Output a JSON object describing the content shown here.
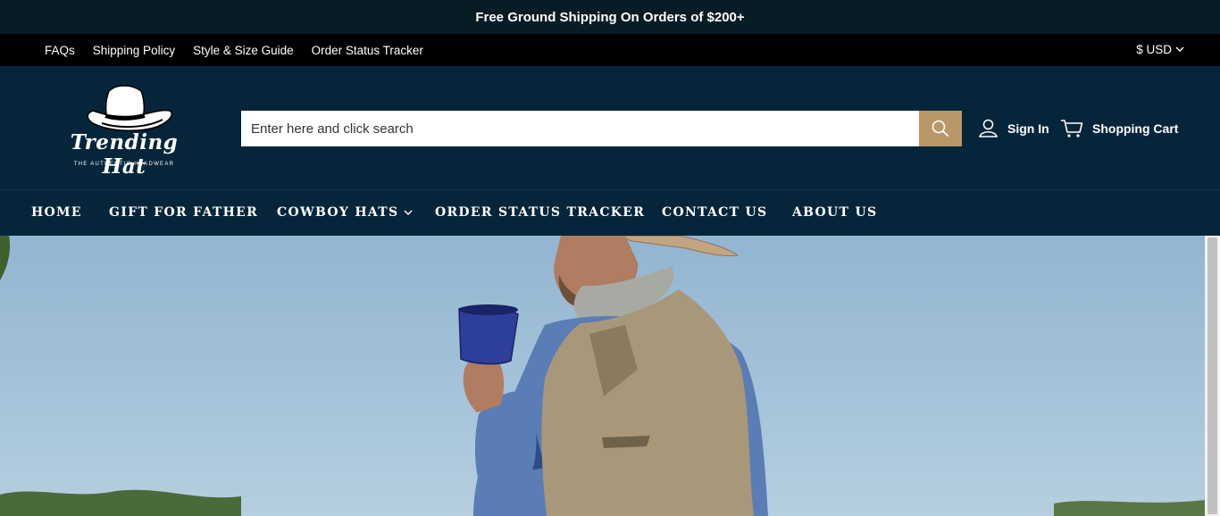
{
  "announcement": "Free Ground Shipping On Orders of $200+",
  "utility_links": [
    "FAQs",
    "Shipping Policy",
    "Style & Size Guide",
    "Order Status Tracker"
  ],
  "currency": "$ USD",
  "logo": {
    "name": "Trending Hat",
    "tagline": "THE AUTHENTIC HEADWEAR"
  },
  "search": {
    "placeholder": "Enter here and click search"
  },
  "account": {
    "sign_in": "Sign In",
    "cart": "Shopping Cart"
  },
  "nav": [
    "HOME",
    "GIFT FOR FATHER",
    "COWBOY HATS",
    "ORDER STATUS TRACKER",
    "CONTACT US",
    "ABOUT US"
  ],
  "colors": {
    "announcement_bg": "#071c24",
    "utility_bg": "#000000",
    "header_bg": "#05263a",
    "accent": "#b99769"
  }
}
